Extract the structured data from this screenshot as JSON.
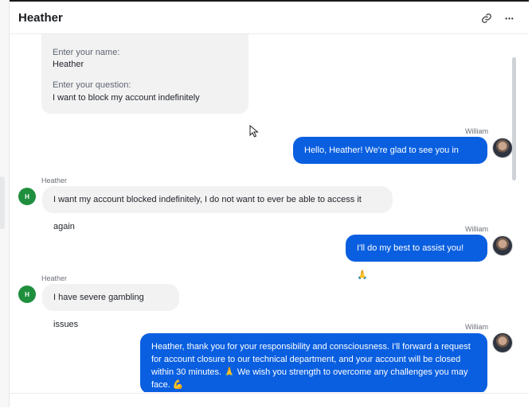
{
  "header": {
    "title": "Heather",
    "link_icon": "link-icon",
    "more_icon": "more-horizontal-icon",
    "more_glyph": "•••"
  },
  "form": {
    "name_label": "Enter your name:",
    "name_value": "Heather",
    "question_label": "Enter your question:",
    "question_value": "I want to block my account indefinitely"
  },
  "messages": [
    {
      "sender": "William",
      "direction": "out",
      "text": "Hello, Heather! We're glad to see you in chat."
    },
    {
      "sender": "Heather",
      "direction": "in",
      "avatar_letter": "H",
      "text": "I want my account blocked indefinitely, I do not want to ever be able to access it again"
    },
    {
      "sender": "William",
      "direction": "out",
      "text": "I'll do my best to assist you! 🙏"
    },
    {
      "sender": "Heather",
      "direction": "in",
      "avatar_letter": "H",
      "text": "I have severe gambling issues"
    },
    {
      "sender": "William",
      "direction": "out",
      "text": "Heather, thank you for your responsibility and consciousness. I'll forward a request for account closure to our technical department, and your account will be closed within 30 minutes. 🙏 We wish you strength to overcome any challenges you may face. 💪"
    }
  ],
  "colors": {
    "outgoing_bubble": "#0a5fe0",
    "incoming_bubble": "#f2f2f3",
    "agent_avatar": "#1f8f3e"
  }
}
